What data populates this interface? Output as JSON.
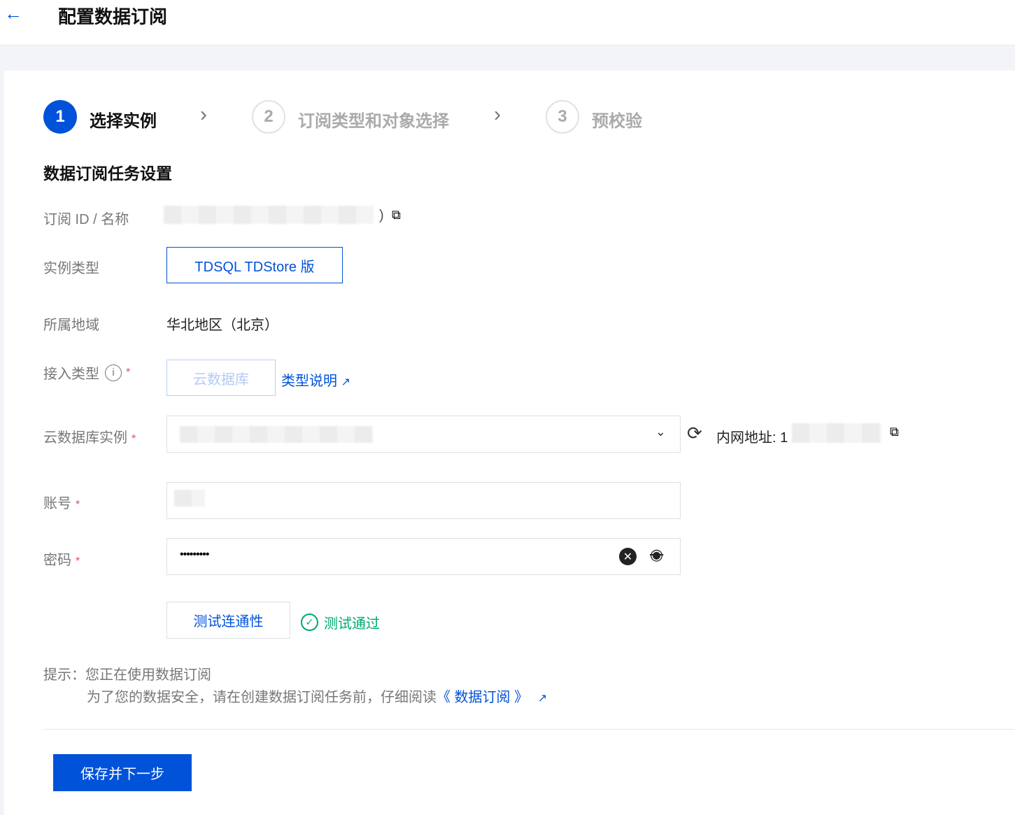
{
  "header": {
    "back_icon": "arrow-left-icon",
    "title": "配置数据订阅"
  },
  "steps": [
    {
      "num": "1",
      "label": "选择实例",
      "active": true
    },
    {
      "num": "2",
      "label": "订阅类型和对象选择",
      "active": false
    },
    {
      "num": "3",
      "label": "预校验",
      "active": false
    }
  ],
  "section_title": "数据订阅任务设置",
  "form": {
    "sub_id_label": "订阅 ID / 名称",
    "sub_id_suffix": ")",
    "instance_type_label": "实例类型",
    "instance_type_value": "TDSQL TDStore 版",
    "region_label": "所属地域",
    "region_value": "华北地区（北京）",
    "access_type_label": "接入类型",
    "access_type_value": "云数据库",
    "type_doc_link": "类型说明",
    "db_instance_label": "云数据库实例",
    "intranet_label": "内网地址: 1",
    "account_label": "账号",
    "password_label": "密码",
    "password_value": "•••••••••",
    "test_button": "测试连通性",
    "test_status": "测试通过",
    "required_mark": "*"
  },
  "tip": {
    "line1": "提示：您正在使用数据订阅",
    "line2": "为了您的数据安全，请在创建数据订阅任务前，仔细阅读",
    "link": "《 数据订阅 》"
  },
  "footer": {
    "save_button": "保存并下一步"
  },
  "colors": {
    "primary": "#0052d9",
    "success": "#00a870",
    "required": "#e34d59"
  }
}
